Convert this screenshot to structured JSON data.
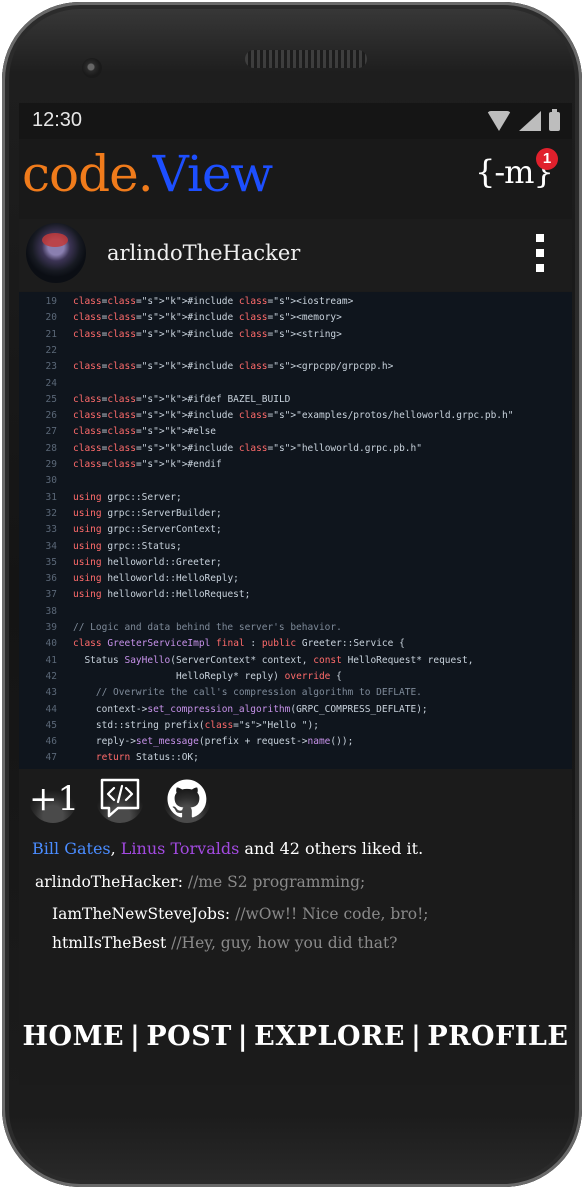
{
  "status_bar": {
    "time": "12:30"
  },
  "app": {
    "logo_part1": "code.",
    "logo_part2": "View",
    "brand_mark": "{-m}",
    "notification_count": "1",
    "colors": {
      "orange": "#f07b1b",
      "blue": "#1d4fff"
    }
  },
  "post": {
    "author": "arlindoTheHacker",
    "code_lines": [
      {
        "n": "19",
        "t": "#include <iostream>"
      },
      {
        "n": "20",
        "t": "#include <memory>"
      },
      {
        "n": "21",
        "t": "#include <string>"
      },
      {
        "n": "22",
        "t": ""
      },
      {
        "n": "23",
        "t": "#include <grpcpp/grpcpp.h>"
      },
      {
        "n": "24",
        "t": ""
      },
      {
        "n": "25",
        "t": "#ifdef BAZEL_BUILD"
      },
      {
        "n": "26",
        "t": "#include \"examples/protos/helloworld.grpc.pb.h\""
      },
      {
        "n": "27",
        "t": "#else"
      },
      {
        "n": "28",
        "t": "#include \"helloworld.grpc.pb.h\""
      },
      {
        "n": "29",
        "t": "#endif"
      },
      {
        "n": "30",
        "t": ""
      },
      {
        "n": "31",
        "t": "using grpc::Server;"
      },
      {
        "n": "32",
        "t": "using grpc::ServerBuilder;"
      },
      {
        "n": "33",
        "t": "using grpc::ServerContext;"
      },
      {
        "n": "34",
        "t": "using grpc::Status;"
      },
      {
        "n": "35",
        "t": "using helloworld::Greeter;"
      },
      {
        "n": "36",
        "t": "using helloworld::HelloReply;"
      },
      {
        "n": "37",
        "t": "using helloworld::HelloRequest;"
      },
      {
        "n": "38",
        "t": ""
      },
      {
        "n": "39",
        "t": "// Logic and data behind the server's behavior."
      },
      {
        "n": "40",
        "t": "class GreeterServiceImpl final : public Greeter::Service {"
      },
      {
        "n": "41",
        "t": "  Status SayHello(ServerContext* context, const HelloRequest* request,"
      },
      {
        "n": "42",
        "t": "                  HelloReply* reply) override {"
      },
      {
        "n": "43",
        "t": "    // Overwrite the call's compression algorithm to DEFLATE."
      },
      {
        "n": "44",
        "t": "    context->set_compression_algorithm(GRPC_COMPRESS_DEFLATE);"
      },
      {
        "n": "45",
        "t": "    std::string prefix(\"Hello \");"
      },
      {
        "n": "46",
        "t": "    reply->set_message(prefix + request->name());"
      },
      {
        "n": "47",
        "t": "    return Status::OK;"
      }
    ],
    "actions": {
      "plus_one": "+1"
    },
    "likes": {
      "name1": "Bill Gates",
      "sep": ", ",
      "name2": "Linus Torvalds",
      "rest": " and 42 others liked it."
    },
    "comments": [
      {
        "user": "arlindoTheHacker:",
        "text": " //me S2 programming;"
      },
      {
        "user": "IamTheNewSteveJobs:",
        "text": " //wOw!! Nice code, bro!;"
      },
      {
        "user": "htmlIsTheBest",
        "text": "  //Hey, guy, how you did that?"
      }
    ]
  },
  "bottom_nav": {
    "home": "HOME",
    "post": "POST",
    "explore": "EXPLORE",
    "profile": "PROFILE",
    "separator": "|"
  }
}
